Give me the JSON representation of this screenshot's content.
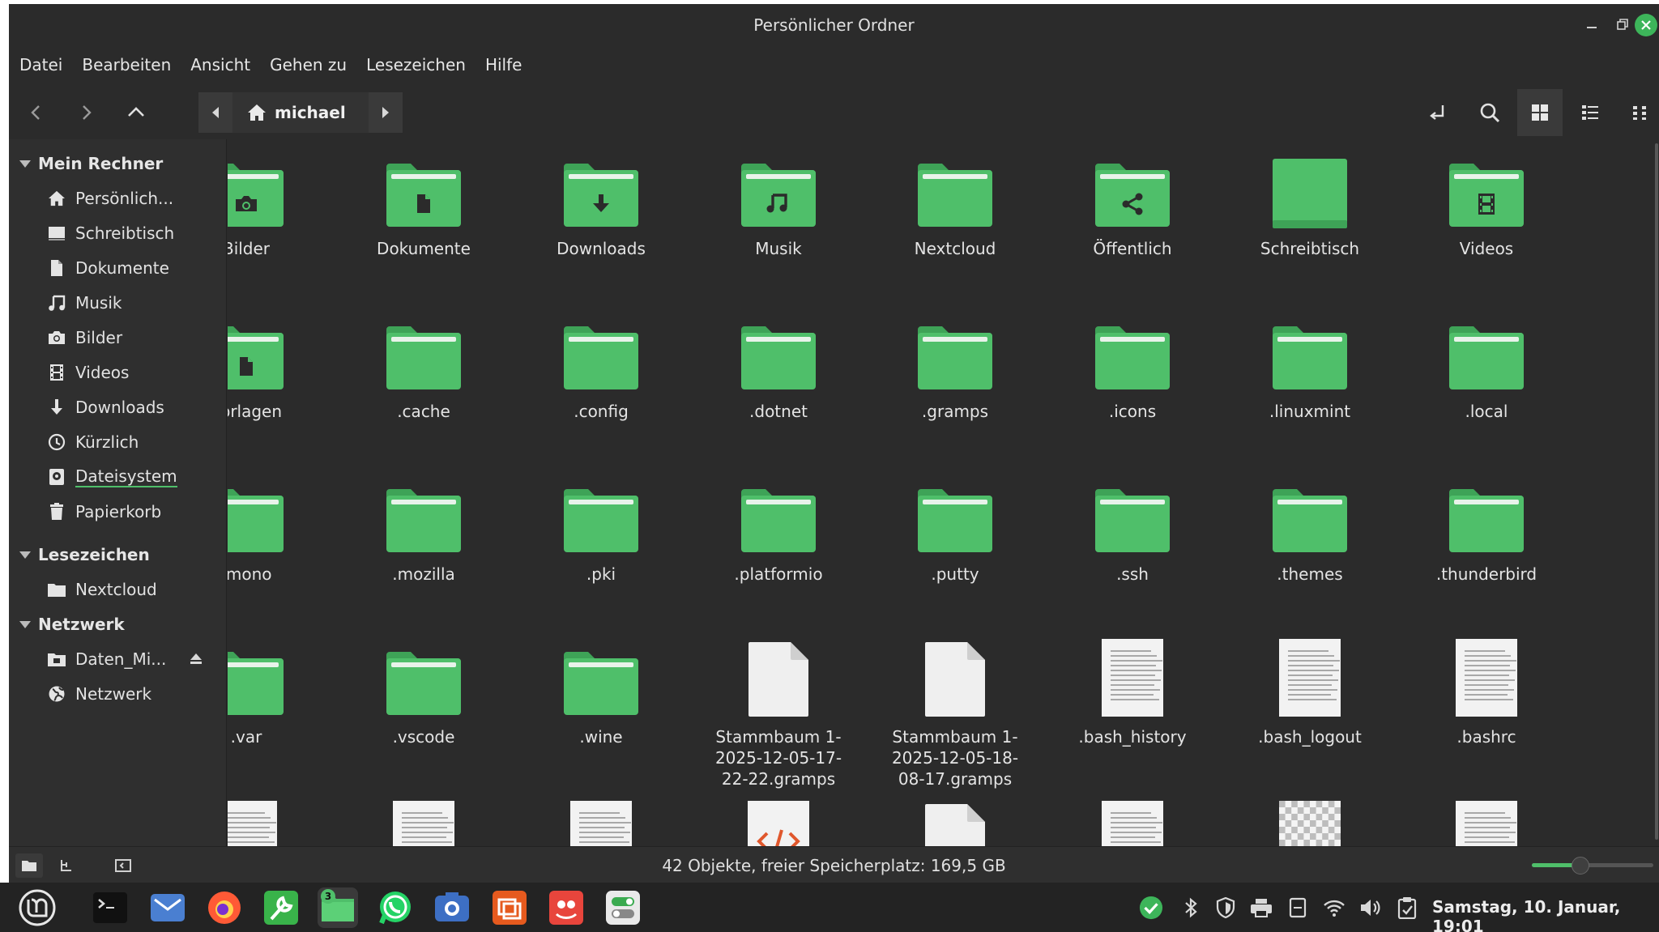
{
  "window": {
    "title": "Persönlicher Ordner"
  },
  "menu": [
    "Datei",
    "Bearbeiten",
    "Ansicht",
    "Gehen zu",
    "Lesezeichen",
    "Hilfe"
  ],
  "path": {
    "current": "michael"
  },
  "sidebar": {
    "sections": [
      {
        "title": "Mein Rechner",
        "items": [
          {
            "label": "Persönlich...",
            "icon": "home-icon"
          },
          {
            "label": "Schreibtisch",
            "icon": "desktop-icon"
          },
          {
            "label": "Dokumente",
            "icon": "document-icon"
          },
          {
            "label": "Musik",
            "icon": "music-icon"
          },
          {
            "label": "Bilder",
            "icon": "camera-icon"
          },
          {
            "label": "Videos",
            "icon": "film-icon"
          },
          {
            "label": "Downloads",
            "icon": "download-icon"
          },
          {
            "label": "Kürzlich",
            "icon": "clock-icon"
          },
          {
            "label": "Dateisystem",
            "icon": "drive-icon"
          },
          {
            "label": "Papierkorb",
            "icon": "trash-icon"
          }
        ]
      },
      {
        "title": "Lesezeichen",
        "items": [
          {
            "label": "Nextcloud",
            "icon": "folder-icon"
          }
        ]
      },
      {
        "title": "Netzwerk",
        "items": [
          {
            "label": "Daten_Mi...",
            "icon": "network-folder-icon"
          },
          {
            "label": "Netzwerk",
            "icon": "globe-icon"
          }
        ]
      }
    ]
  },
  "files": [
    {
      "name": "Bilder",
      "type": "folder",
      "emblem": "camera"
    },
    {
      "name": "Dokumente",
      "type": "folder",
      "emblem": "document"
    },
    {
      "name": "Downloads",
      "type": "folder",
      "emblem": "download"
    },
    {
      "name": "Musik",
      "type": "folder",
      "emblem": "music"
    },
    {
      "name": "Nextcloud",
      "type": "folder",
      "emblem": "none"
    },
    {
      "name": "Öffentlich",
      "type": "folder",
      "emblem": "share"
    },
    {
      "name": "Schreibtisch",
      "type": "desktop",
      "emblem": "none"
    },
    {
      "name": "Videos",
      "type": "folder",
      "emblem": "film"
    },
    {
      "name": "Vorlagen",
      "type": "folder",
      "emblem": "template"
    },
    {
      "name": ".cache",
      "type": "folder",
      "emblem": "none"
    },
    {
      "name": ".config",
      "type": "folder",
      "emblem": "none"
    },
    {
      "name": ".dotnet",
      "type": "folder",
      "emblem": "none"
    },
    {
      "name": ".gramps",
      "type": "folder",
      "emblem": "none"
    },
    {
      "name": ".icons",
      "type": "folder",
      "emblem": "none"
    },
    {
      "name": ".linuxmint",
      "type": "folder",
      "emblem": "none"
    },
    {
      "name": ".local",
      "type": "folder",
      "emblem": "none"
    },
    {
      "name": ".mono",
      "type": "folder",
      "emblem": "none"
    },
    {
      "name": ".mozilla",
      "type": "folder",
      "emblem": "none"
    },
    {
      "name": ".pki",
      "type": "folder",
      "emblem": "none"
    },
    {
      "name": ".platformio",
      "type": "folder",
      "emblem": "none"
    },
    {
      "name": ".putty",
      "type": "folder",
      "emblem": "none"
    },
    {
      "name": ".ssh",
      "type": "folder",
      "emblem": "none"
    },
    {
      "name": ".themes",
      "type": "folder",
      "emblem": "none"
    },
    {
      "name": ".thunderbird",
      "type": "folder",
      "emblem": "none"
    },
    {
      "name": ".var",
      "type": "folder",
      "emblem": "none"
    },
    {
      "name": ".vscode",
      "type": "folder",
      "emblem": "none"
    },
    {
      "name": ".wine",
      "type": "folder",
      "emblem": "none"
    },
    {
      "name": "Stammbaum 1-2025-12-05-17-22-22.gramps",
      "display": [
        "Stammbaum 1-",
        "2025-12-05-17-",
        "22-22.gramps"
      ],
      "type": "blank"
    },
    {
      "name": "Stammbaum 1-2025-12-05-18-08-17.gramps",
      "display": [
        "Stammbaum 1-",
        "2025-12-05-18-",
        "08-17.gramps"
      ],
      "type": "blank"
    },
    {
      "name": ".bash_history",
      "type": "text"
    },
    {
      "name": ".bash_logout",
      "type": "text"
    },
    {
      "name": ".bashrc",
      "type": "text"
    },
    {
      "name": "",
      "type": "text"
    },
    {
      "name": "",
      "type": "text"
    },
    {
      "name": "",
      "type": "text"
    },
    {
      "name": "",
      "type": "code"
    },
    {
      "name": "",
      "type": "blank"
    },
    {
      "name": "",
      "type": "text"
    },
    {
      "name": "",
      "type": "image"
    },
    {
      "name": "",
      "type": "text"
    }
  ],
  "status": {
    "text": "42 Objekte, freier Speicherplatz: 169,5 GB",
    "zoom_fraction": 0.4
  },
  "taskbar": {
    "apps": [
      "terminal-icon",
      "mail-icon",
      "firefox-icon",
      "settings-tool-icon",
      "files-icon",
      "whatsapp-icon",
      "camera-app-icon",
      "slides-icon",
      "gimp-icon",
      "toggle-app-icon"
    ],
    "files_badge": "3",
    "clock": "Samstag, 10. Januar, 19:01"
  },
  "colors": {
    "folder": "#4fbf6a",
    "folder_dark": "#3ea357",
    "accent": "#4fbf6a",
    "background": "#2b2b2b"
  }
}
